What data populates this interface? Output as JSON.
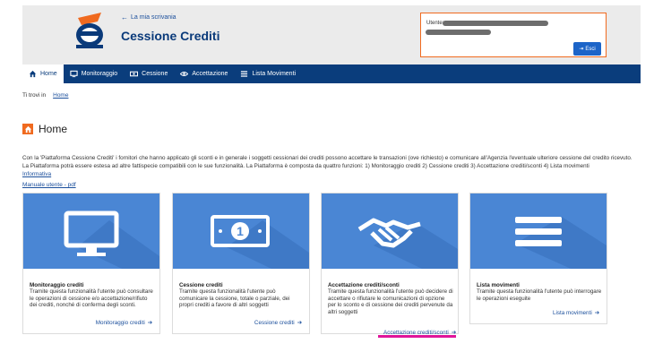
{
  "header": {
    "back_label": "La mia scrivania",
    "title": "Cessione Crediti",
    "user_label": "Utente",
    "logout_label": "Esci"
  },
  "nav": {
    "items": [
      {
        "label": "Home",
        "icon": "home-icon"
      },
      {
        "label": "Monitoraggio",
        "icon": "monitor-icon"
      },
      {
        "label": "Cessione",
        "icon": "banknote-icon"
      },
      {
        "label": "Accettazione",
        "icon": "eye-icon"
      },
      {
        "label": "Lista Movimenti",
        "icon": "list-icon"
      }
    ]
  },
  "breadcrumb": {
    "prefix": "Ti trovi in",
    "current": "Home"
  },
  "page": {
    "title": "Home",
    "intro_line1": "Con la 'Piattaforma Cessione Crediti' i fornitori che hanno applicato gli sconti e in generale i soggetti cessionari dei crediti possono accettare le transazioni (ove richiesto) e comunicare all'Agenzia l'eventuale ulteriore cessione del credito ricevuto.",
    "intro_line2": "La Piattaforma potrà essere estesa ad altre fattispecie compatibili con le sue funzionalità. La Piattaforma è composta da quattro funzioni: 1) Monitoraggio crediti 2) Cessione crediti 3) Accettazione crediti/sconti 4) Lista movimenti",
    "link_info": "Informativa",
    "link_manual": "Manuale utente - pdf"
  },
  "cards": [
    {
      "title": "Monitoraggio crediti",
      "desc": "Tramite questa funzionalità l'utente può consultare le operazioni di cessione e/o accettazione/rifiuto dei crediti, nonché di conferma degli sconti.",
      "link": "Monitoraggio crediti",
      "icon": "monitor-icon"
    },
    {
      "title": "Cessione crediti",
      "desc": "Tramite questa funzionalità l'utente può comunicare la cessione, totale o parziale, dei propri crediti a favore di altri soggetti",
      "link": "Cessione crediti",
      "icon": "banknote-icon"
    },
    {
      "title": "Accettazione crediti/sconti",
      "desc": "Tramite questa funzionalità l'utente può decidere di accettare o rifiutare le comunicazioni di opzione per lo sconto e di cessione dei crediti pervenute da altri soggetti",
      "link": "Accettazione crediti/sconti",
      "icon": "handshake-icon"
    },
    {
      "title": "Lista movimenti",
      "desc": "Tramite questa funzionalità l'utente può interrogare le operazioni eseguite",
      "link": "Lista movimenti",
      "icon": "list-icon"
    }
  ],
  "colors": {
    "nav_bg": "#0a3d7c",
    "card_img": "#4a86d4",
    "accent_orange": "#f06a1f",
    "highlight": "#e0159a",
    "link": "#1b4f9c"
  }
}
